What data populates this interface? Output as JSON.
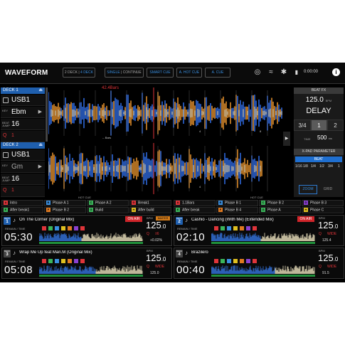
{
  "app": {
    "title": "WAVEFORM"
  },
  "topbar": {
    "deck_mode_a": "2 DECK",
    "deck_mode_b": "4 DECK",
    "play_mode_a": "SINGLE",
    "play_mode_b": "CONTINUE",
    "smart_cue": "SMART CUE",
    "hot_cue": "A. HOT CUE",
    "a_cue": "A. CUE",
    "clock": "0:00:00"
  },
  "decks_left": [
    {
      "label": "DECK 1",
      "source": "USB1",
      "key_lbl": "KEY",
      "key": "Ebm",
      "beatjump_lbl": "BEAT JUMP",
      "beatjump": "16",
      "quantize": "Q",
      "quantize_val": "1"
    },
    {
      "label": "DECK 2",
      "source": "USB1",
      "key_lbl": "KEY",
      "key": "Gm",
      "beatjump_lbl": "BEAT JUMP",
      "beatjump": "16",
      "quantize": "Q",
      "quantize_val": "1"
    }
  ],
  "waveform": {
    "bars_label": "42.4Bars",
    "bars_small": "-- Bars",
    "marker_a": "4",
    "marker_b": "8",
    "marker_c": "4"
  },
  "beat_fx": {
    "title": "BEAT FX",
    "bpm": "125.0",
    "bpm_sub": "BPM",
    "name": "DELAY",
    "beats": [
      "3/4",
      "1",
      "2"
    ],
    "selected_beat": "1",
    "time_label": "TIME",
    "time_value": "500",
    "time_unit": "ms",
    "xpad_title": "X-PAD PARAMETER",
    "xpad_mode": "BEAT",
    "xpad_values": [
      "1/16",
      "1/8",
      "1/4",
      "1/2",
      "3/4",
      "1"
    ]
  },
  "view": {
    "zoom": "ZOOM",
    "grid": "GRID"
  },
  "hot_cue": {
    "title_left": "HOT CUE",
    "title_right": "HOT CUE",
    "left": [
      {
        "key": "A",
        "label": "Intro",
        "color": "#e0353a"
      },
      {
        "key": "B",
        "label": "Phase A 1",
        "color": "#3a8fe0"
      },
      {
        "key": "C",
        "label": "Phase A 2",
        "color": "#3bb55a"
      },
      {
        "key": "D",
        "label": "Break1",
        "color": "#e0353a"
      },
      {
        "key": "E",
        "label": "After break1",
        "color": "#3bb55a"
      },
      {
        "key": "F",
        "label": "Phase B 2",
        "color": "#e07a20"
      },
      {
        "key": "G",
        "label": "Build",
        "color": "#3bb55a"
      },
      {
        "key": "H",
        "label": "After build",
        "color": "#e0c020"
      }
    ],
    "right": [
      {
        "key": "A",
        "label": "1.1Bars",
        "color": "#e0353a"
      },
      {
        "key": "B",
        "label": "Phase B 1",
        "color": "#3a8fe0"
      },
      {
        "key": "C",
        "label": "Phase B 2",
        "color": "#3bb55a"
      },
      {
        "key": "D",
        "label": "Phase B 3",
        "color": "#8a40d0"
      },
      {
        "key": "E",
        "label": "After break",
        "color": "#3bb55a"
      },
      {
        "key": "F",
        "label": "Phase B 4",
        "color": "#e07a20"
      },
      {
        "key": "G",
        "label": "Phase A",
        "color": "#3bb55a"
      },
      {
        "key": "H",
        "label": "Phase C",
        "color": "#e0c020"
      }
    ]
  },
  "strips": [
    {
      "deck_lbl": "DECK",
      "deck": "1",
      "track": "On The Corner (Original Mix)",
      "onair": "ON AIR",
      "remain": "REMAIN / TIME",
      "time": "05:30",
      "bpm_lbl": "BPM",
      "master": "MASTER",
      "bpm": "125",
      "bpm_dec": ".0",
      "q": "Q",
      "range": "±6",
      "pitch": "+0.02%",
      "key": "",
      "active": true
    },
    {
      "deck_lbl": "DECK",
      "deck": "2",
      "track": "Cashio - Dancing (With Me) (Extended Mix)",
      "onair": "ON AIR",
      "remain": "REMAIN / TIME",
      "time": "02:10",
      "bpm_lbl": "BPM",
      "master": "",
      "bpm": "125",
      "bpm_dec": ".0",
      "q": "Q",
      "range": "WIDE",
      "pitch": "125.4",
      "key": "",
      "active": true
    },
    {
      "deck_lbl": "DECK",
      "deck": "3",
      "track": "Wrap Me Up feat Mari.M (Original Mix)",
      "onair": "",
      "remain": "REMAIN / TIME",
      "time": "05:08",
      "bpm_lbl": "BPM",
      "master": "",
      "bpm": "125",
      "bpm_dec": ".0",
      "q": "Q",
      "range": "WIDE",
      "pitch": "125.0",
      "key": "",
      "active": false
    },
    {
      "deck_lbl": "DECK",
      "deck": "4",
      "track": "Brazilero",
      "onair": "",
      "remain": "REMAIN / TIME",
      "time": "00:40",
      "bpm_lbl": "BPM",
      "master": "",
      "bpm": "125",
      "bpm_dec": ".0",
      "q": "Q",
      "range": "WIDE",
      "pitch": "91.5",
      "key": "",
      "active": false
    }
  ]
}
